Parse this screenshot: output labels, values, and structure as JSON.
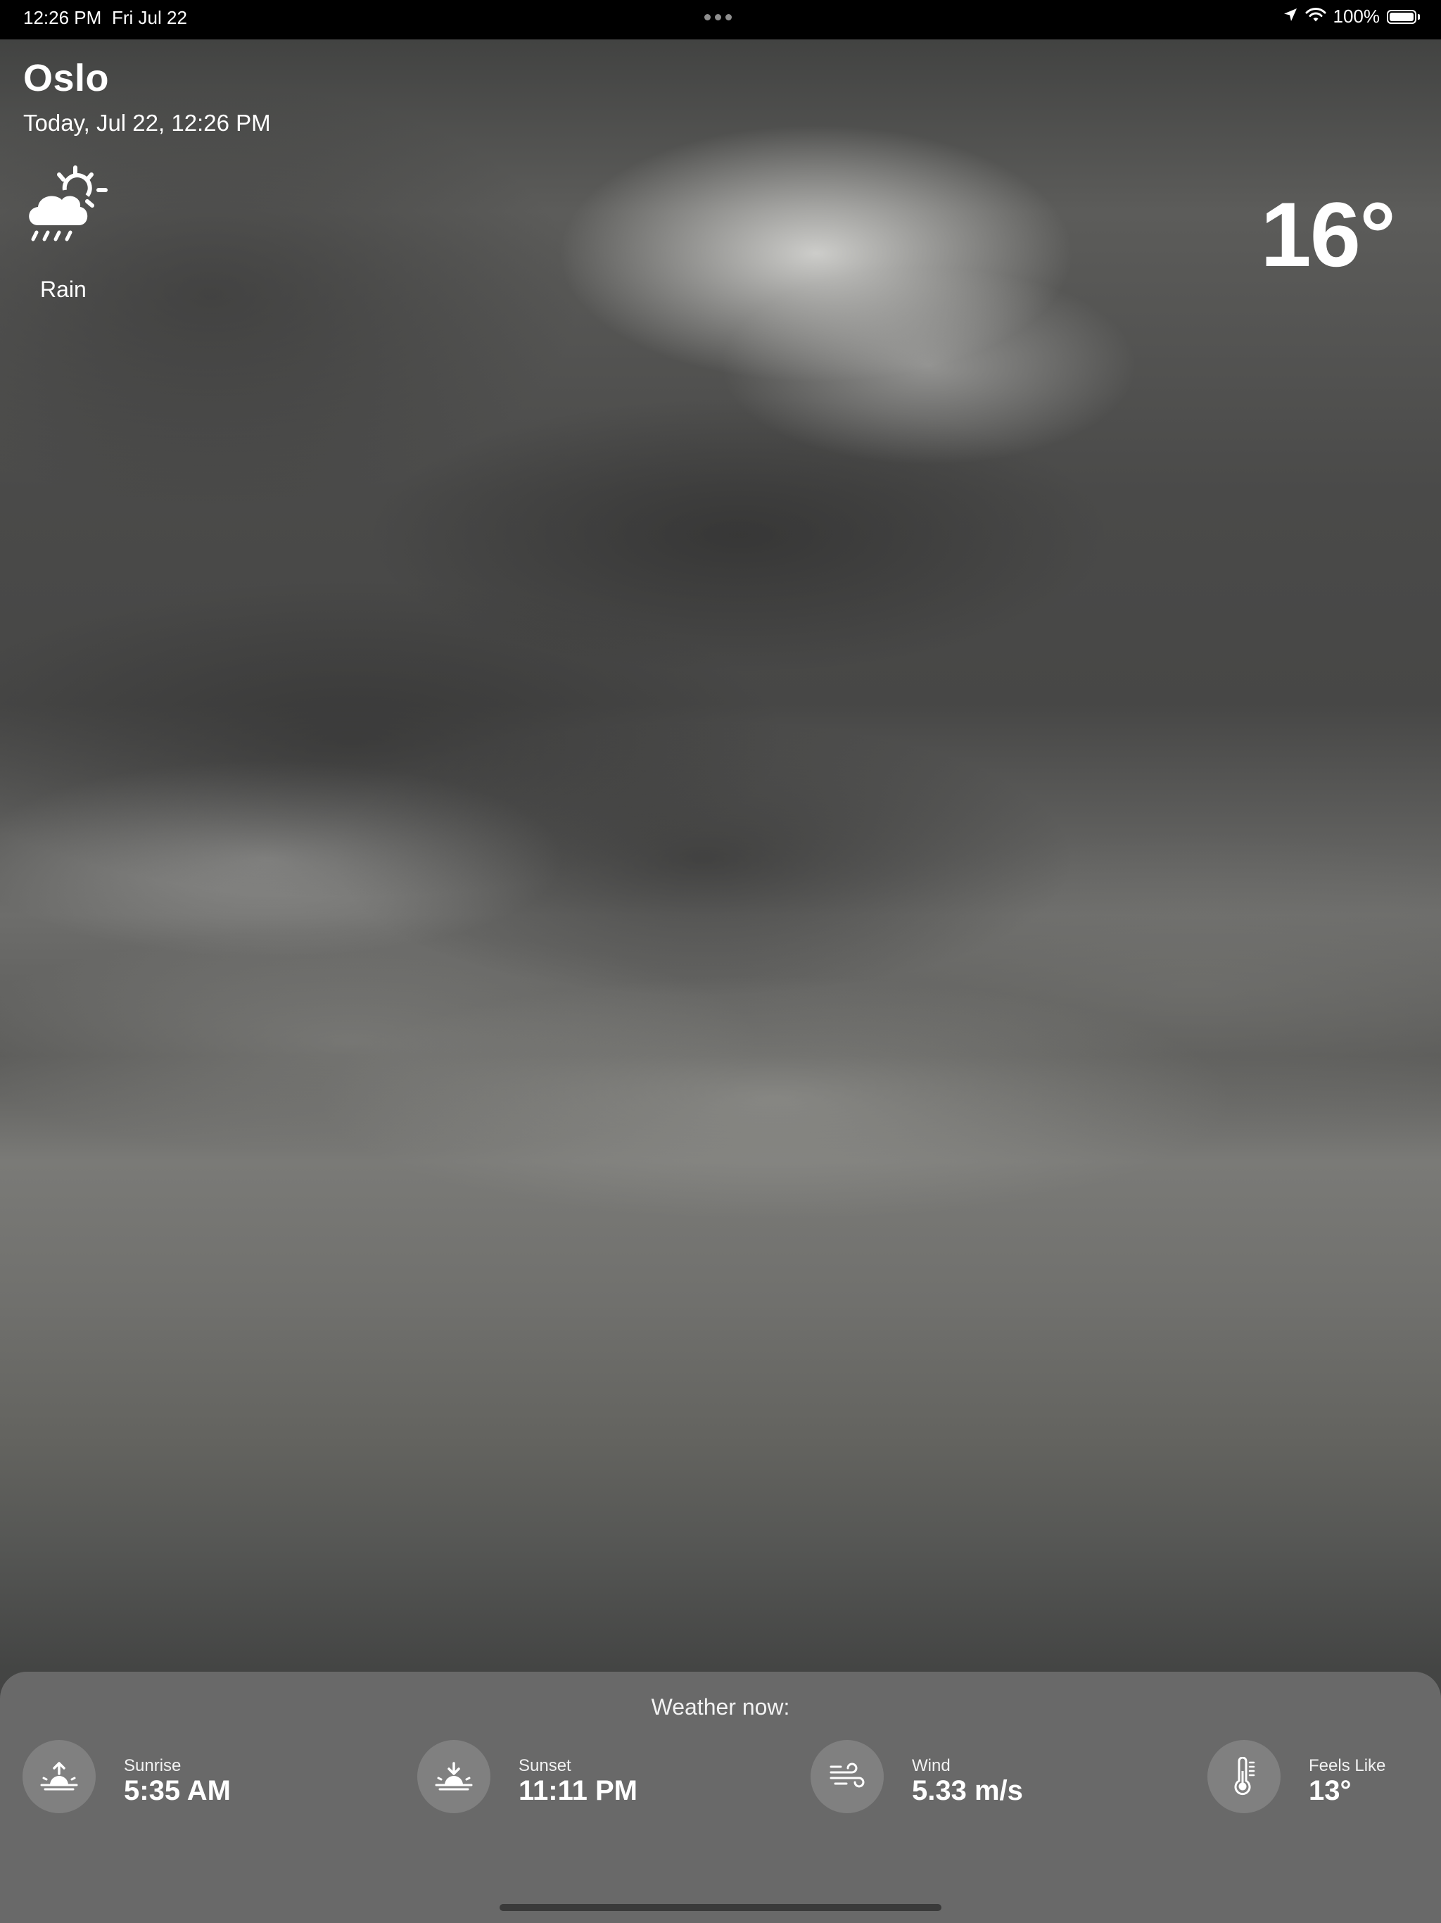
{
  "status_bar": {
    "time": "12:26 PM",
    "date": "Fri Jul 22",
    "battery": "100%",
    "icons": [
      "location-arrow-icon",
      "wifi-icon",
      "battery-icon"
    ]
  },
  "weather": {
    "city": "Oslo",
    "datetime": "Today, Jul 22, 12:26 PM",
    "condition": "Rain",
    "condition_icon": "cloud-sun-rain-icon",
    "temperature": "16°"
  },
  "panel": {
    "title": "Weather now:",
    "metrics": [
      {
        "label": "Sunrise",
        "value": "5:35 AM",
        "icon": "sunrise-icon"
      },
      {
        "label": "Sunset",
        "value": "11:11 PM",
        "icon": "sunset-icon"
      },
      {
        "label": "Wind",
        "value": "5.33 m/s",
        "icon": "wind-icon"
      },
      {
        "label": "Feels Like",
        "value": "13°",
        "icon": "thermometer-icon"
      }
    ]
  }
}
